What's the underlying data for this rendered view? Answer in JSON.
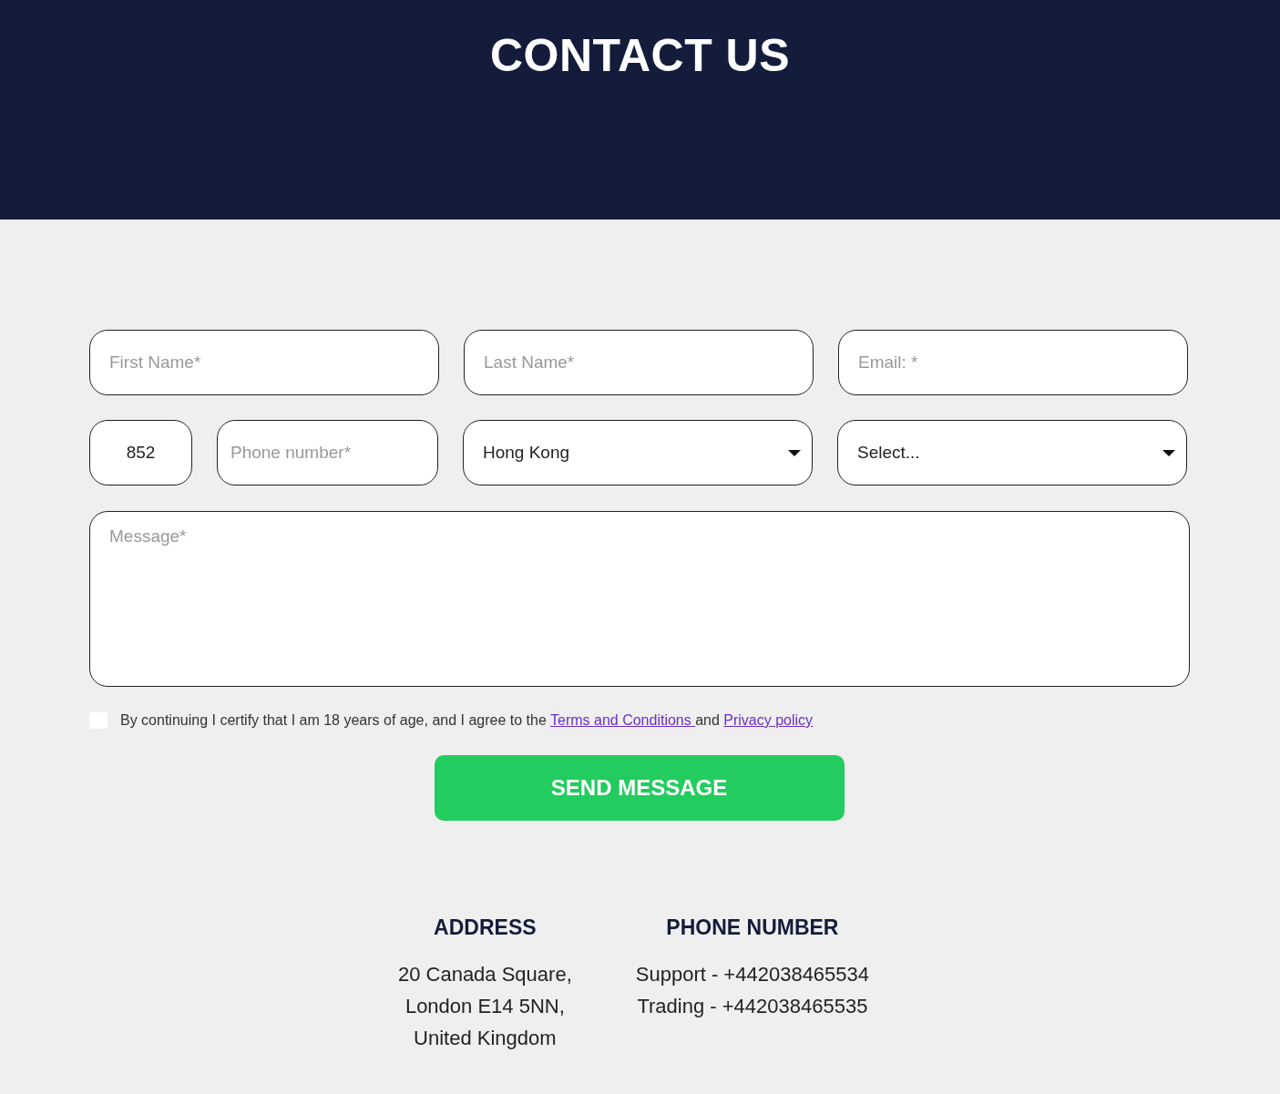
{
  "header": {
    "title": "CONTACT US"
  },
  "form": {
    "fields": [
      {
        "kind": "input",
        "placeholder": "First Name*"
      },
      {
        "kind": "input",
        "placeholder": "Last Name*"
      },
      {
        "kind": "input",
        "placeholder": "Email: *"
      },
      {
        "kind": "input",
        "value": "852"
      },
      {
        "kind": "input",
        "placeholder": "Phone number*"
      },
      {
        "kind": "select",
        "value": "Hong Kong"
      },
      {
        "kind": "select",
        "value": "Select..."
      }
    ],
    "message": {
      "placeholder": "Message*"
    },
    "consent": {
      "checked": false,
      "parts": [
        {
          "kind": "text",
          "text": "By continuing I certify that I am 18 years of age, and I agree to the "
        },
        {
          "kind": "link",
          "text": "Terms and Conditions "
        },
        {
          "kind": "text",
          "text": "and "
        },
        {
          "kind": "link",
          "text": "Privacy policy"
        }
      ]
    },
    "submit": "SEND MESSAGE"
  },
  "contacts": [
    {
      "heading": "ADDRESS",
      "lines": [
        "20 Canada Square,",
        "London E14 5NN,",
        "United Kingdom"
      ]
    },
    {
      "heading": "PHONE NUMBER",
      "lines": [
        "Support - +442038465534",
        "Trading - +442038465535"
      ]
    }
  ]
}
